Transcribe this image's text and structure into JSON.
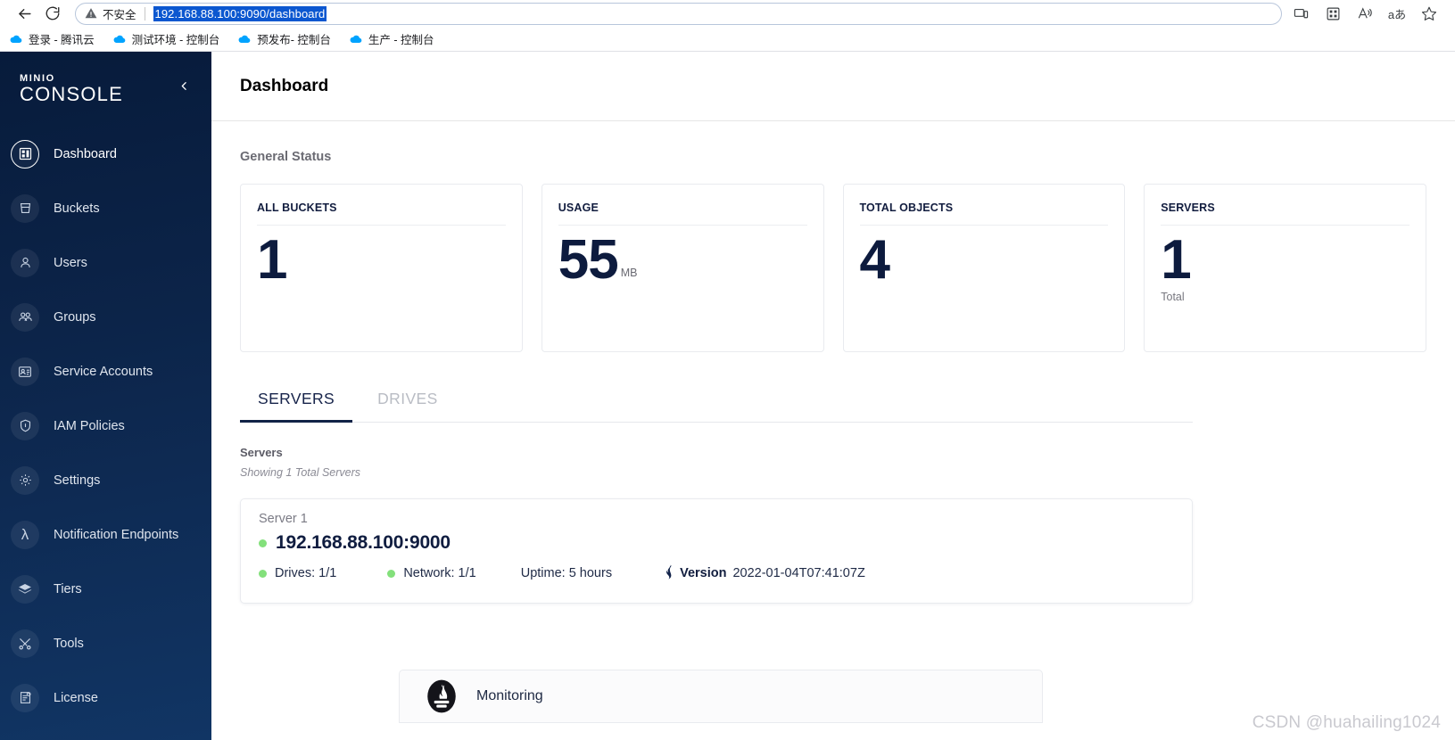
{
  "browser": {
    "back_icon": "back-arrow-icon",
    "reload_icon": "reload-icon",
    "security_text": "不安全",
    "url": "192.168.88.100:9090/dashboard",
    "toolbar_icons": [
      "device-cast-icon",
      "collections-icon",
      "read-aloud-icon",
      "translate-icon",
      "favorites-star-icon"
    ],
    "bookmarks": [
      {
        "label": "登录 - 腾讯云"
      },
      {
        "label": "测试环境 - 控制台"
      },
      {
        "label": "预发布- 控制台"
      },
      {
        "label": "生产 - 控制台"
      }
    ]
  },
  "sidebar": {
    "logo_top": "MINIO",
    "logo_bottom": "CONSOLE",
    "collapse_icon": "chevron-left-icon",
    "items": [
      {
        "label": "Dashboard",
        "icon": "dashboard-icon",
        "active": true
      },
      {
        "label": "Buckets",
        "icon": "bucket-icon",
        "active": false
      },
      {
        "label": "Users",
        "icon": "user-icon",
        "active": false
      },
      {
        "label": "Groups",
        "icon": "groups-icon",
        "active": false
      },
      {
        "label": "Service Accounts",
        "icon": "service-account-icon",
        "active": false
      },
      {
        "label": "IAM Policies",
        "icon": "shield-icon",
        "active": false
      },
      {
        "label": "Settings",
        "icon": "gear-icon",
        "active": false
      },
      {
        "label": "Notification Endpoints",
        "icon": "lambda-icon",
        "active": false
      },
      {
        "label": "Tiers",
        "icon": "layers-icon",
        "active": false
      },
      {
        "label": "Tools",
        "icon": "tools-icon",
        "active": false
      },
      {
        "label": "License",
        "icon": "license-icon",
        "active": false
      }
    ]
  },
  "header": {
    "title": "Dashboard"
  },
  "general_status": {
    "section_label": "General Status",
    "cards": [
      {
        "label": "ALL BUCKETS",
        "value": "1",
        "unit": "",
        "sub": ""
      },
      {
        "label": "USAGE",
        "value": "55",
        "unit": "MB",
        "sub": ""
      },
      {
        "label": "TOTAL OBJECTS",
        "value": "4",
        "unit": "",
        "sub": ""
      },
      {
        "label": "SERVERS",
        "value": "1",
        "unit": "",
        "sub": "Total"
      }
    ]
  },
  "tabs": [
    {
      "label": "SERVERS",
      "active": true
    },
    {
      "label": "DRIVES",
      "active": false
    }
  ],
  "servers_section": {
    "title": "Servers",
    "note": "Showing 1 Total Servers",
    "server": {
      "name": "Server 1",
      "address": "192.168.88.100:9000",
      "status_color": "#83e07b",
      "drives": "Drives: 1/1",
      "network": "Network: 1/1",
      "uptime": "Uptime: 5 hours",
      "version_icon": "minio-bird-icon",
      "version_label": "Version",
      "version_value": "2022-01-04T07:41:07Z"
    }
  },
  "monitoring": {
    "icon": "prometheus-icon",
    "label": "Monitoring"
  },
  "watermark": "CSDN @huahailing1024",
  "colors": {
    "sidebar_dark": "#071b3b",
    "sidebar_light": "#113564",
    "accent_navy": "#0d1b3e",
    "status_green": "#83e07b",
    "url_highlight": "#0b57d0"
  }
}
